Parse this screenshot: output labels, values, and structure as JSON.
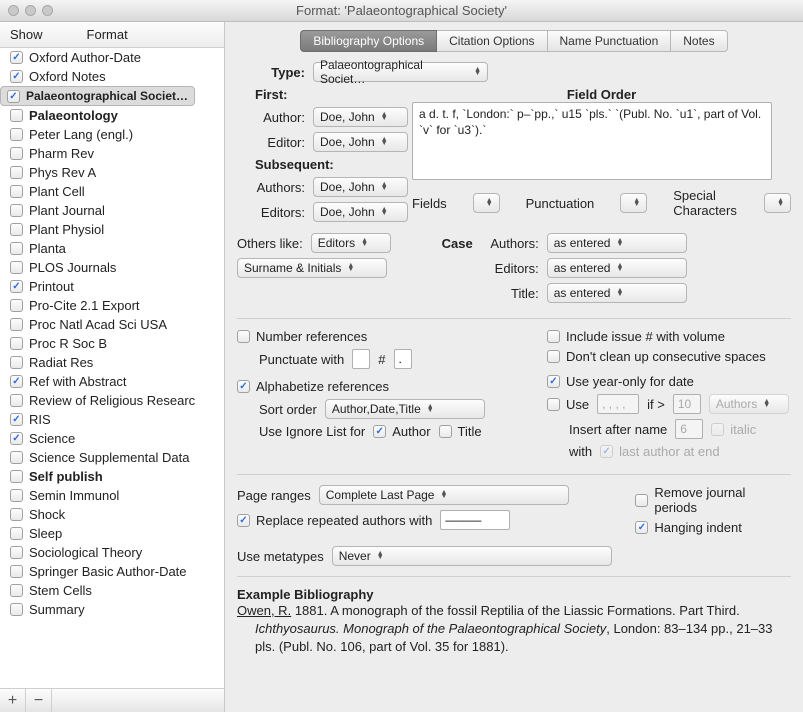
{
  "title": "Format: 'Palaeontographical Society'",
  "sidebar": {
    "header": {
      "show": "Show",
      "format": "Format"
    },
    "items": [
      {
        "label": "Oxford Author-Date",
        "checked": true
      },
      {
        "label": "Oxford Notes",
        "checked": true
      },
      {
        "label": "Palaeontographical Societ…",
        "checked": true,
        "selected": true
      },
      {
        "label": "Palaeontology",
        "checked": false,
        "bold": true
      },
      {
        "label": "Peter Lang (engl.)",
        "checked": false
      },
      {
        "label": "Pharm Rev",
        "checked": false
      },
      {
        "label": "Phys Rev A",
        "checked": false
      },
      {
        "label": "Plant Cell",
        "checked": false
      },
      {
        "label": "Plant Journal",
        "checked": false
      },
      {
        "label": "Plant Physiol",
        "checked": false
      },
      {
        "label": "Planta",
        "checked": false
      },
      {
        "label": "PLOS Journals",
        "checked": false
      },
      {
        "label": "Printout",
        "checked": true
      },
      {
        "label": "Pro-Cite 2.1 Export",
        "checked": false
      },
      {
        "label": "Proc Natl Acad Sci USA",
        "checked": false
      },
      {
        "label": "Proc R Soc B",
        "checked": false
      },
      {
        "label": "Radiat Res",
        "checked": false
      },
      {
        "label": "Ref with Abstract",
        "checked": true
      },
      {
        "label": "Review of Religious Researc",
        "checked": false
      },
      {
        "label": "RIS",
        "checked": true
      },
      {
        "label": "Science",
        "checked": true
      },
      {
        "label": "Science Supplemental Data",
        "checked": false
      },
      {
        "label": "Self publish",
        "checked": false,
        "bold": true
      },
      {
        "label": "Semin Immunol",
        "checked": false
      },
      {
        "label": "Shock",
        "checked": false
      },
      {
        "label": "Sleep",
        "checked": false
      },
      {
        "label": "Sociological Theory",
        "checked": false
      },
      {
        "label": "Springer Basic Author-Date",
        "checked": false
      },
      {
        "label": "Stem Cells",
        "checked": false
      },
      {
        "label": "Summary",
        "checked": false
      }
    ]
  },
  "tabs": [
    "Bibliography Options",
    "Citation Options",
    "Name Punctuation",
    "Notes"
  ],
  "type": {
    "label": "Type:",
    "value": "Palaeontographical Societ…"
  },
  "first": {
    "heading": "First:",
    "author_label": "Author:",
    "author_value": "Doe, John",
    "editor_label": "Editor:",
    "editor_value": "Doe, John"
  },
  "subsequent": {
    "heading": "Subsequent:",
    "authors_label": "Authors:",
    "authors_value": "Doe, John",
    "editors_label": "Editors:",
    "editors_value": "Doe, John"
  },
  "field_order": {
    "heading": "Field Order",
    "content": "a d. t. f, `London:` p–`pp.,` u15 `pls.` `(Publ. No. `u1`, part of Vol. `v` for `u3`).`",
    "fields_label": "Fields",
    "punctuation_label": "Punctuation",
    "special_label": "Special Characters"
  },
  "others": {
    "label": "Others like:",
    "value": "Editors",
    "style": "Surname & Initials"
  },
  "case": {
    "heading": "Case",
    "authors_label": "Authors:",
    "authors_value": "as entered",
    "editors_label": "Editors:",
    "editors_value": "as entered",
    "title_label": "Title:",
    "title_value": "as entered"
  },
  "refs": {
    "number_label": "Number references",
    "punctuate_label": "Punctuate with",
    "punct_pre": "",
    "punct_mid": "#",
    "punct_post": ".",
    "include_issue": "Include issue # with volume",
    "dont_clean": "Don't clean up consecutive spaces",
    "alphabetize": "Alphabetize references",
    "sort_label": "Sort order",
    "sort_value": "Author,Date,Title",
    "ignore_label": "Use Ignore List for",
    "ignore_author": "Author",
    "ignore_title": "Title",
    "year_only": "Use year-only for date",
    "use_label": "Use",
    "use_sep": ", , , ,",
    "if_gt": "if >",
    "if_gt_val": "10",
    "if_gt_who": "Authors",
    "insert_label": "Insert after name",
    "insert_val": "6",
    "italic": "italic",
    "with_label": "with",
    "last_author": "last author at end"
  },
  "page": {
    "label": "Page ranges",
    "value": "Complete Last Page",
    "remove_journal": "Remove journal periods",
    "replace_label": "Replace repeated authors with",
    "replace_value": "———",
    "hanging": "Hanging indent"
  },
  "meta": {
    "label": "Use metatypes",
    "value": "Never"
  },
  "example": {
    "heading": "Example Bibliography",
    "author": "Owen, R.",
    "year": "1881.",
    "title": "A monograph of the fossil Reptilia of the Liassic Formations. Part Third.",
    "journal": "Ichthyosaurus. Monograph of the Palaeontographical Society",
    "rest": ", London: 83–134 pp., 21–33 pls. (Publ. No. 106, part of Vol. 35 for 1881)."
  }
}
